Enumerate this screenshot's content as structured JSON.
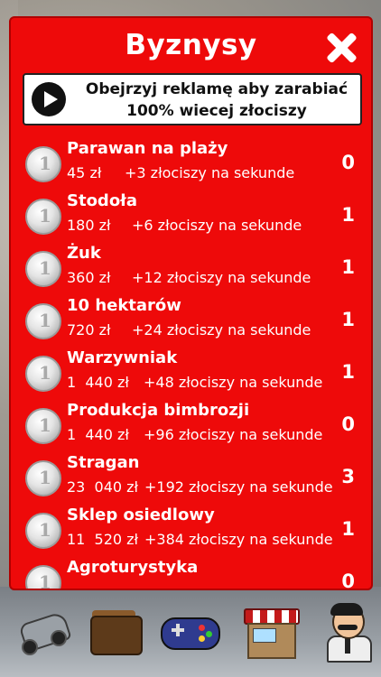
{
  "panel": {
    "title": "Byznysy",
    "close_icon": "close-icon"
  },
  "ad_banner": {
    "icon": "play-icon",
    "line1": "Obejrzyj reklamę aby zarabiać",
    "line2": "100% wiecej złociszy"
  },
  "businesses": [
    {
      "name": "Parawan na plaży",
      "price": "45 zł",
      "income": "+3 złociszy na sekunde",
      "count": "0"
    },
    {
      "name": "Stodoła",
      "price": "180 zł",
      "income": "+6 złociszy na sekunde",
      "count": "1"
    },
    {
      "name": "Żuk",
      "price": "360 zł",
      "income": "+12 złociszy na sekunde",
      "count": "1"
    },
    {
      "name": "10 hektarów",
      "price": "720 zł",
      "income": "+24 złociszy na sekunde",
      "count": "1"
    },
    {
      "name": "Warzywniak",
      "price": "1  440 zł",
      "income": "+48 złociszy na sekunde",
      "count": "1"
    },
    {
      "name": "Produkcja bimbrozji",
      "price": "1  440 zł",
      "income": "+96 złociszy na sekunde",
      "count": "0"
    },
    {
      "name": "Stragan",
      "price": "23  040 zł",
      "income": "+192 złociszy na sekunde",
      "count": "3"
    },
    {
      "name": "Sklep osiedlowy",
      "price": "11  520 zł",
      "income": "+384 złociszy na sekunde",
      "count": "1"
    },
    {
      "name": "Agroturystyka",
      "price": "",
      "income": "",
      "count": "0"
    }
  ],
  "bottom_nav": {
    "items": [
      "car-icon",
      "wallet-icon",
      "gamepad-icon",
      "shop-icon",
      "person-icon"
    ]
  },
  "colors": {
    "panel_red": "#ee0a0a",
    "text_white": "#ffffff"
  }
}
